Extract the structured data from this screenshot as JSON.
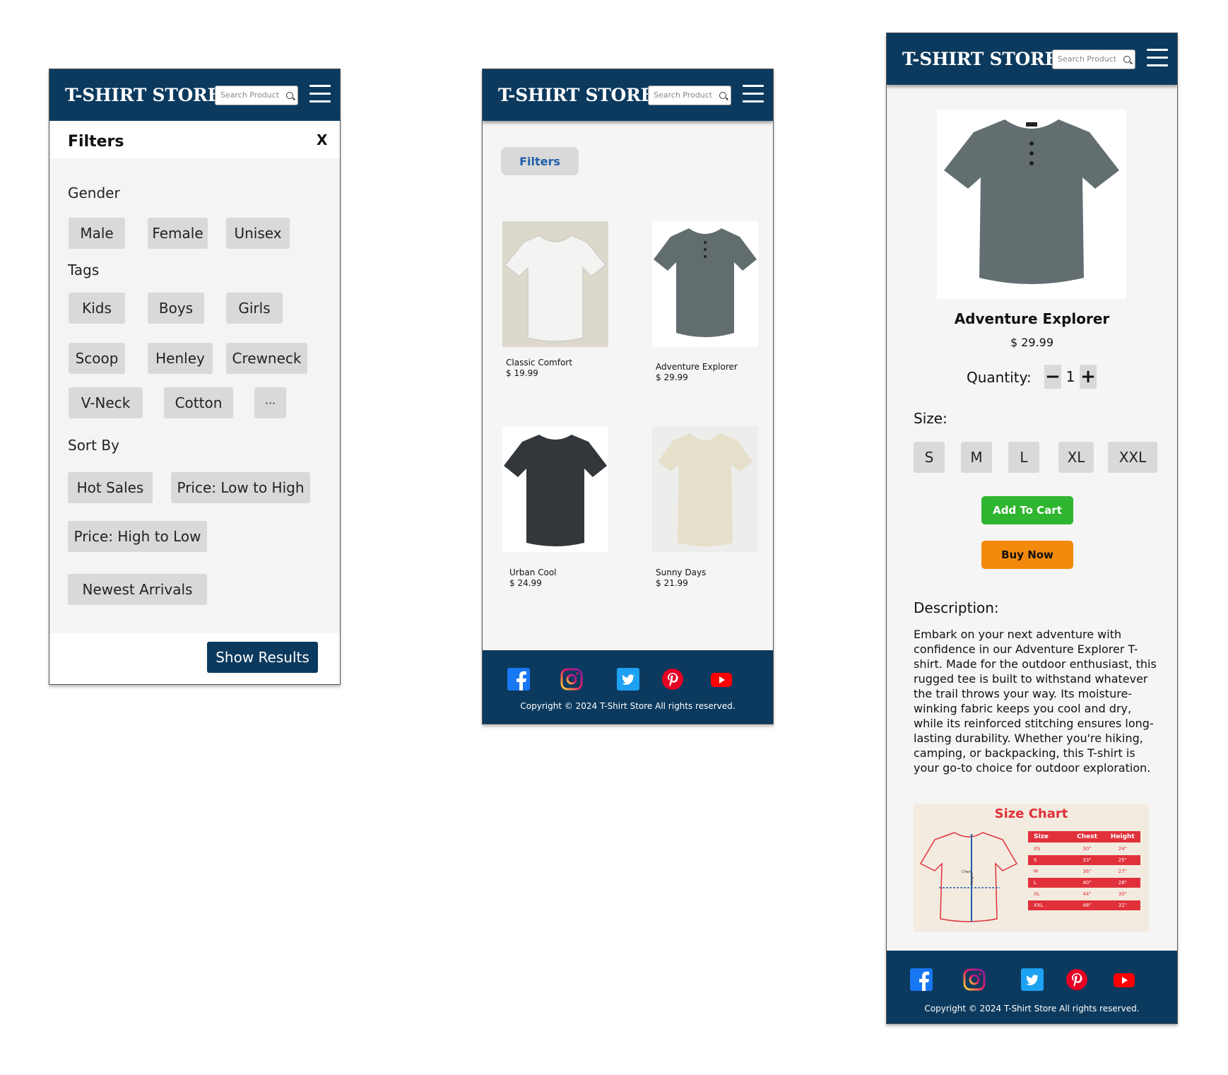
{
  "store": {
    "name": "T-SHIRT STORE",
    "search_placeholder": "Search Product"
  },
  "filters_panel": {
    "title": "Filters",
    "close_label": "X",
    "gender_label": "Gender",
    "gender": [
      "Male",
      "Female",
      "Unisex"
    ],
    "tags_label": "Tags",
    "tags": [
      "Kids",
      "Boys",
      "Girls",
      "Scoop",
      "Henley",
      "Crewneck",
      "V-Neck",
      "Cotton",
      "···"
    ],
    "sort_label": "Sort By",
    "sort": [
      "Hot Sales",
      "Price: Low to High",
      "Price: High to Low",
      "Newest Arrivals"
    ],
    "show_results_label": "Show Results"
  },
  "listing": {
    "filters_button": "Filters",
    "products": [
      {
        "name": "Classic Comfort",
        "price": "$ 19.99",
        "color": "#f2f2f0"
      },
      {
        "name": "Adventure Explorer",
        "price": "$ 29.99",
        "color": "#5e6a6c"
      },
      {
        "name": "Urban Cool",
        "price": "$ 24.99",
        "color": "#33373b"
      },
      {
        "name": "Sunny Days",
        "price": "$ 21.99",
        "color": "#e4dcc6"
      }
    ]
  },
  "product": {
    "name": "Adventure Explorer",
    "price": "$ 29.99",
    "quantity_label": "Quantity:",
    "quantity": "1",
    "minus": "−",
    "plus": "+",
    "size_label": "Size:",
    "sizes": [
      "S",
      "M",
      "L",
      "XL",
      "XXL"
    ],
    "add_to_cart": "Add To Cart",
    "buy_now": "Buy Now",
    "description_label": "Description:",
    "description": "Embark on your next adventure with confidence in our Adventure Explorer T-shirt. Made for the outdoor enthusiast, this rugged tee is built to withstand whatever the trail throws your way. Its moisture-winking fabric keeps you cool and dry, while its reinforced stitching ensures long-lasting durability. Whether you're hiking, camping, or backpacking, this T-shirt is your go-to choice for outdoor exploration.",
    "size_chart": {
      "title": "Size Chart",
      "chest_label": "Chest",
      "height_label": "Height",
      "headers": [
        "Size",
        "Chest",
        "Height"
      ],
      "rows": [
        [
          "XS",
          "30\"",
          "24\""
        ],
        [
          "S",
          "33\"",
          "25\""
        ],
        [
          "M",
          "36\"",
          "27\""
        ],
        [
          "L",
          "40\"",
          "28\""
        ],
        [
          "XL",
          "44\"",
          "30\""
        ],
        [
          "XXL",
          "48\"",
          "31\""
        ]
      ]
    }
  },
  "footer": {
    "copyright": "Copyright © 2024 T-Shirt Store All rights reserved.",
    "social": [
      "facebook-icon",
      "instagram-icon",
      "twitter-icon",
      "pinterest-icon",
      "youtube-icon"
    ]
  },
  "colors": {
    "navy": "#0c3a5e",
    "chip": "#d9d9d9",
    "add_to_cart": "#2fb52f",
    "buy_now": "#f2890c",
    "chart_red": "#e0303a"
  }
}
